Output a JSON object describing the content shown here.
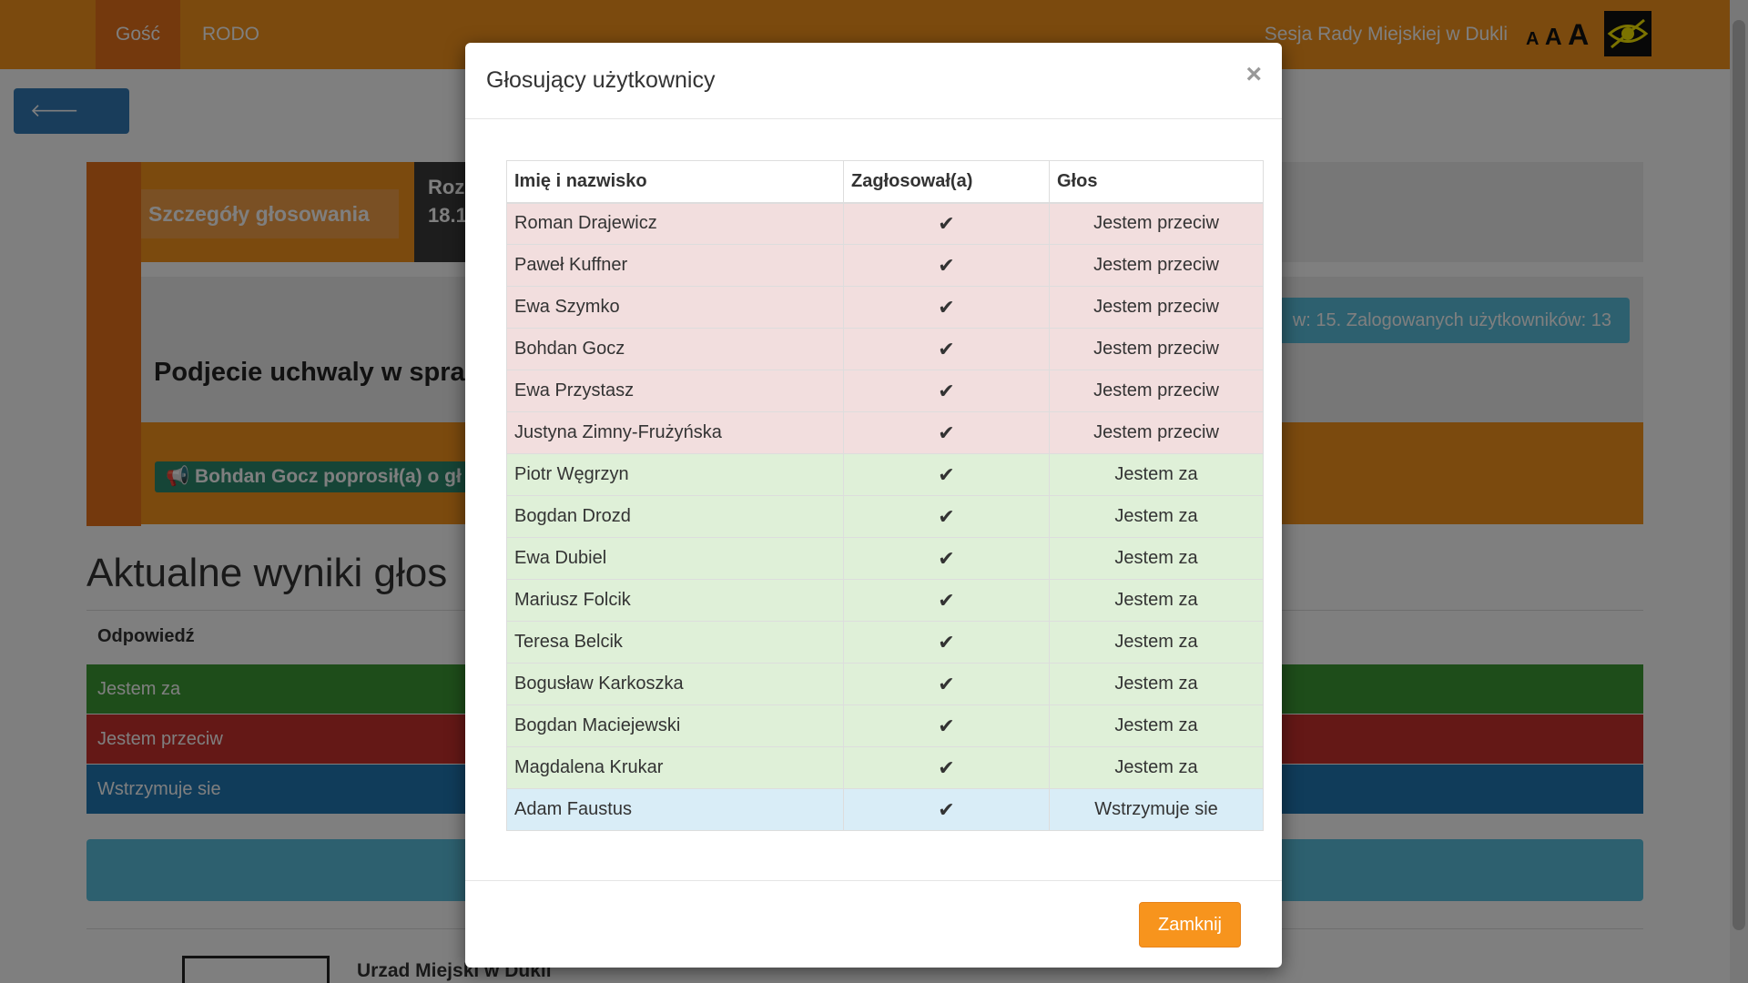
{
  "nav": {
    "guest": "Gość",
    "rodo": "RODO",
    "title": "Sesja Rady Miejskiej w Dukli",
    "font_small": "A",
    "font_medium": "A",
    "font_large": "A"
  },
  "back_label": "Powrót",
  "details_label": "Szczegóły głosowania",
  "dark_box": {
    "line1": "Roz",
    "line2": "18.1"
  },
  "subject": "Podjecie uchwaly w spra",
  "info_badge": "w: 15. Zalogowanych użytkowników: 13",
  "speak_badge": "Bohdan Gocz poprosił(a) o gł",
  "results": {
    "title": "Aktualne wyniki głos",
    "header": "Odpowiedź",
    "rows": [
      "Jestem za",
      "Jestem przeciw",
      "Wstrzymuje sie"
    ]
  },
  "footer": {
    "text": "Urzad Miejski w Dukli"
  },
  "modal": {
    "title": "Głosujący użytkownicy",
    "close_glyph": "×",
    "columns": [
      "Imię i nazwisko",
      "Zagłosował(a)",
      "Głos"
    ],
    "check_glyph": "✔",
    "rows": [
      {
        "name": "Roman Drajewicz",
        "vote": "Jestem przeciw",
        "kind": "against"
      },
      {
        "name": "Paweł Kuffner",
        "vote": "Jestem przeciw",
        "kind": "against"
      },
      {
        "name": "Ewa Szymko",
        "vote": "Jestem przeciw",
        "kind": "against"
      },
      {
        "name": "Bohdan Gocz",
        "vote": "Jestem przeciw",
        "kind": "against"
      },
      {
        "name": "Ewa Przystasz",
        "vote": "Jestem przeciw",
        "kind": "against"
      },
      {
        "name": "Justyna Zimny-Frużyńska",
        "vote": "Jestem przeciw",
        "kind": "against"
      },
      {
        "name": "Piotr Węgrzyn",
        "vote": "Jestem za",
        "kind": "for"
      },
      {
        "name": "Bogdan Drozd",
        "vote": "Jestem za",
        "kind": "for"
      },
      {
        "name": "Ewa Dubiel",
        "vote": "Jestem za",
        "kind": "for"
      },
      {
        "name": "Mariusz Folcik",
        "vote": "Jestem za",
        "kind": "for"
      },
      {
        "name": "Teresa Belcik",
        "vote": "Jestem za",
        "kind": "for"
      },
      {
        "name": "Bogusław Karkoszka",
        "vote": "Jestem za",
        "kind": "for"
      },
      {
        "name": "Bogdan Maciejewski",
        "vote": "Jestem za",
        "kind": "for"
      },
      {
        "name": "Magdalena Krukar",
        "vote": "Jestem za",
        "kind": "for"
      },
      {
        "name": "Adam Faustus",
        "vote": "Wstrzymuje sie",
        "kind": "abstain"
      }
    ],
    "close_label": "Zamknij"
  },
  "colors": {
    "brand_orange": "#f7941d",
    "against_row": "#f2dede",
    "for_row": "#dff0d8",
    "abstain_row": "#d9edf7"
  }
}
